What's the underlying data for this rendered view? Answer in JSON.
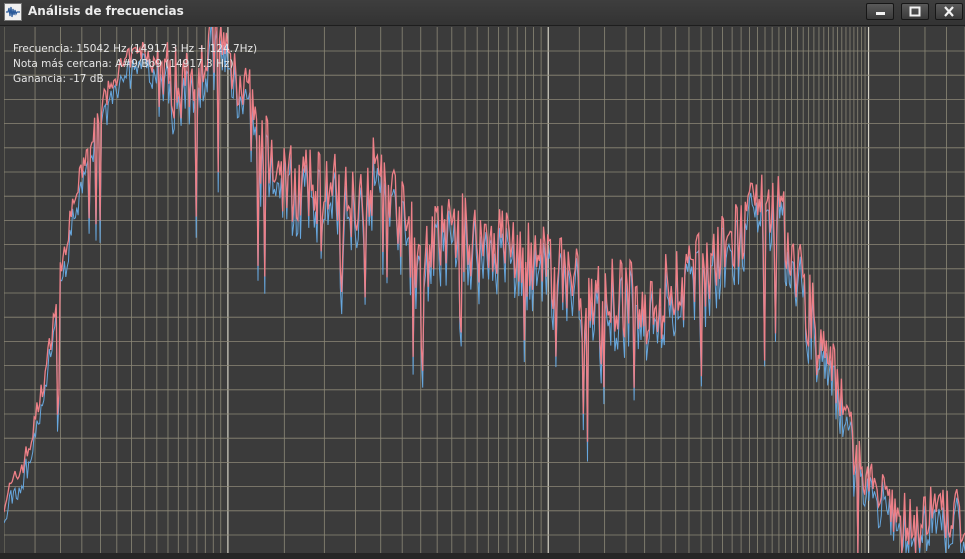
{
  "window": {
    "title": "Análisis de frecuencias",
    "app_icon": "waveform-icon",
    "controls": {
      "minimize_icon": "minimize-icon",
      "maximize_icon": "maximize-icon",
      "close_icon": "close-icon"
    }
  },
  "info": {
    "frequency": "Frecuencia: 15042 Hz (14917.3 Hz + 124.7Hz)",
    "nearest_note": "Nota más cercana: A#9/Bb9 (14917.3 Hz)",
    "gain": "Ganancia: -17 dB"
  },
  "colors": {
    "background": "#3b3b3b",
    "grid_minor": "#8c8877",
    "grid_major": "#d6d3c6",
    "spectrum_main": "#ee8088",
    "spectrum_peak": "#67a7de"
  },
  "chart_data": {
    "type": "line",
    "x_scale": "log",
    "grid": true,
    "series": [
      {
        "values": [
          [
            20,
            -81
          ],
          [
            22,
            -77
          ],
          [
            24,
            -72
          ],
          [
            27,
            -59
          ],
          [
            30,
            -42
          ],
          [
            33,
            -30
          ],
          [
            36,
            -22
          ],
          [
            40,
            -14
          ],
          [
            45,
            -8
          ],
          [
            50,
            -5
          ],
          [
            55,
            -4
          ],
          [
            60,
            -7
          ],
          [
            70,
            -10
          ],
          [
            80,
            -6
          ],
          [
            90,
            -3
          ],
          [
            100,
            -5
          ],
          [
            110,
            -8
          ],
          [
            125,
            -20
          ],
          [
            140,
            -24
          ],
          [
            160,
            -27
          ],
          [
            180,
            -28
          ],
          [
            200,
            -26
          ],
          [
            230,
            -30
          ],
          [
            260,
            -28
          ],
          [
            300,
            -24
          ],
          [
            350,
            -33
          ],
          [
            400,
            -40
          ],
          [
            450,
            -36
          ],
          [
            500,
            -34
          ],
          [
            600,
            -37
          ],
          [
            700,
            -36
          ],
          [
            800,
            -38
          ],
          [
            900,
            -41
          ],
          [
            1000,
            -41
          ],
          [
            1200,
            -43
          ],
          [
            1400,
            -47
          ],
          [
            1700,
            -46
          ],
          [
            2000,
            -48
          ],
          [
            2500,
            -44
          ],
          [
            3000,
            -42
          ],
          [
            3500,
            -39
          ],
          [
            4000,
            -35
          ],
          [
            5000,
            -30
          ],
          [
            5500,
            -35
          ],
          [
            6000,
            -41
          ],
          [
            7000,
            -54
          ],
          [
            8000,
            -60
          ],
          [
            9000,
            -72
          ],
          [
            10000,
            -78
          ],
          [
            12000,
            -83
          ],
          [
            14000,
            -85
          ],
          [
            16000,
            -83
          ],
          [
            18000,
            -84
          ],
          [
            20000,
            -84
          ]
        ]
      }
    ]
  }
}
